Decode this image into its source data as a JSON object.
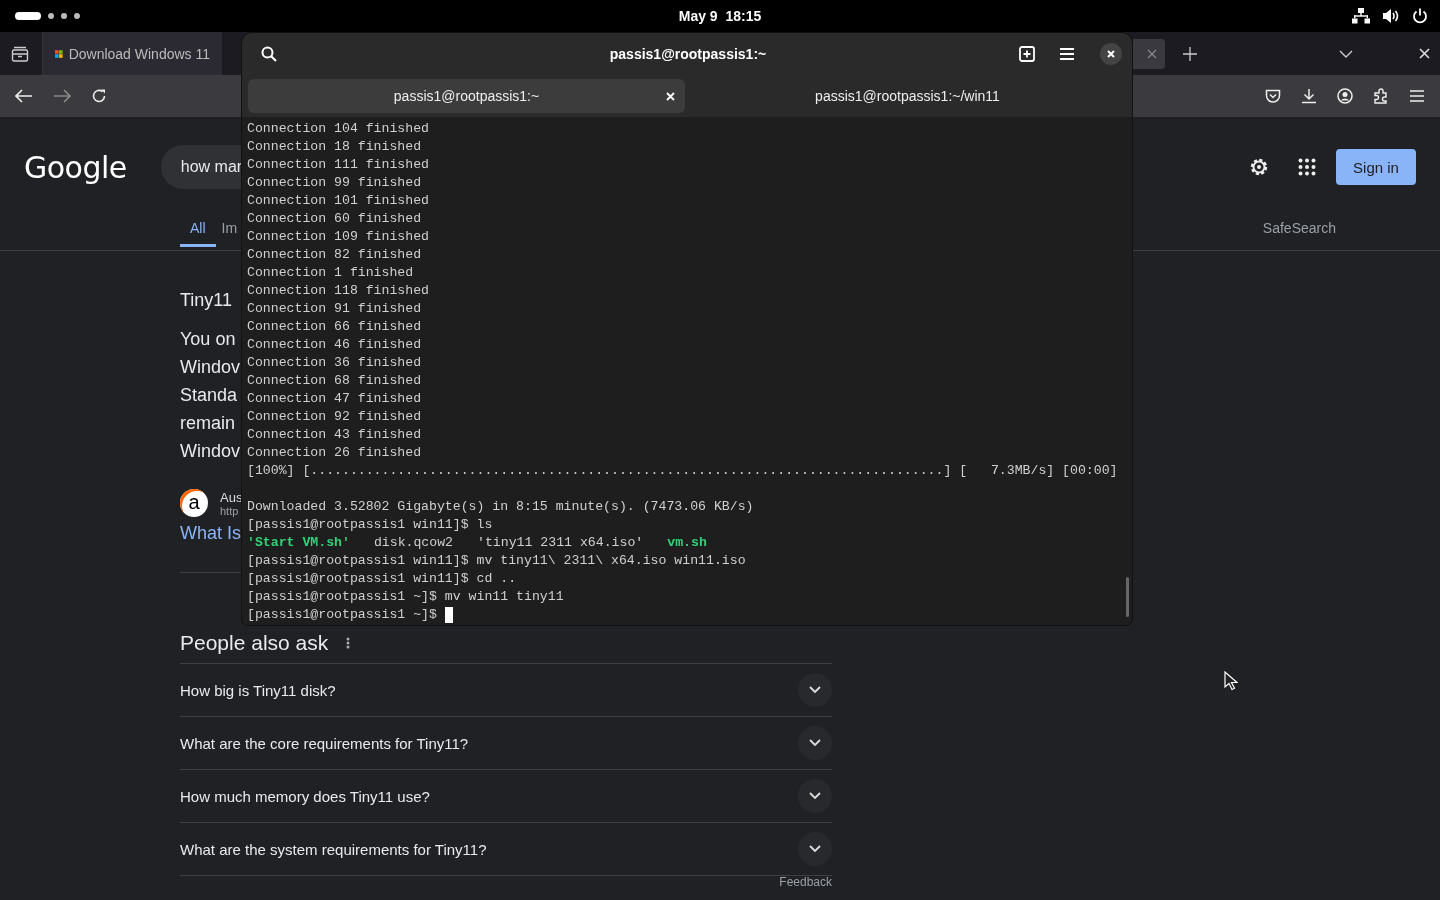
{
  "top_bar": {
    "clock": "May 9  18:15"
  },
  "browser": {
    "tabs": [
      {
        "title": "Download Windows 11",
        "selected": true
      }
    ],
    "page": {
      "logo": "Google",
      "search_query": "how mar",
      "sign_in": "Sign in",
      "search_tabs": [
        {
          "label": "All",
          "selected": true
        },
        {
          "label": "Im",
          "selected": false
        }
      ],
      "safesearch": "SafeSearch",
      "result_title": "Tiny11",
      "snippet_lines": [
        "You on",
        "Windov",
        "Standa",
        "remain",
        "Windov"
      ],
      "source": {
        "icon_letter": "a",
        "name": "Aus",
        "url": "http"
      },
      "link": "What Is",
      "people_also_ask": {
        "title": "People also ask",
        "questions": [
          {
            "text": "How big is Tiny11 disk?",
            "expanded": false
          },
          {
            "text": "What are the core requirements for Tiny11?",
            "expanded": false
          },
          {
            "text": "How much memory does Tiny11 use?",
            "expanded": false
          },
          {
            "text": "What are the system requirements for Tiny11?",
            "expanded": false
          }
        ],
        "feedback": "Feedback"
      }
    }
  },
  "terminal": {
    "title": "passis1@rootpassis1:~",
    "tabs": [
      {
        "label": "passis1@rootpassis1:~",
        "selected": true
      },
      {
        "label": "passis1@rootpassis1:~/win11",
        "selected": false
      }
    ],
    "lines": [
      {
        "kind": "text",
        "text": "Connection 104 finished"
      },
      {
        "kind": "text",
        "text": "Connection 18 finished"
      },
      {
        "kind": "text",
        "text": "Connection 111 finished"
      },
      {
        "kind": "text",
        "text": "Connection 99 finished"
      },
      {
        "kind": "text",
        "text": "Connection 101 finished"
      },
      {
        "kind": "text",
        "text": "Connection 60 finished"
      },
      {
        "kind": "text",
        "text": "Connection 109 finished"
      },
      {
        "kind": "text",
        "text": "Connection 82 finished"
      },
      {
        "kind": "text",
        "text": "Connection 1 finished"
      },
      {
        "kind": "text",
        "text": "Connection 118 finished"
      },
      {
        "kind": "text",
        "text": "Connection 91 finished"
      },
      {
        "kind": "text",
        "text": "Connection 66 finished"
      },
      {
        "kind": "text",
        "text": "Connection 46 finished"
      },
      {
        "kind": "text",
        "text": "Connection 36 finished"
      },
      {
        "kind": "text",
        "text": "Connection 68 finished"
      },
      {
        "kind": "text",
        "text": "Connection 47 finished"
      },
      {
        "kind": "text",
        "text": "Connection 92 finished"
      },
      {
        "kind": "text",
        "text": "Connection 43 finished"
      },
      {
        "kind": "text",
        "text": "Connection 26 finished"
      },
      {
        "kind": "text",
        "text": "[100%] [................................................................................] [   7.3MB/s] [00:00]"
      },
      {
        "kind": "blank"
      },
      {
        "kind": "text",
        "text": "Downloaded 3.52802 Gigabyte(s) in 8:15 minute(s). (7473.06 KB/s)"
      },
      {
        "kind": "text",
        "text": "[passis1@rootpassis1 win11]$ ls"
      },
      {
        "kind": "listing",
        "items": [
          {
            "text": "'Start VM.sh'",
            "color": "#33d17a"
          },
          {
            "text": "disk.qcow2",
            "color": "#d0d0d0"
          },
          {
            "text": "'tiny11 2311 x64.iso'",
            "color": "#d0d0d0"
          },
          {
            "text": "vm.sh",
            "color": "#33d17a"
          }
        ]
      },
      {
        "kind": "text",
        "text": "[passis1@rootpassis1 win11]$ mv tiny11\\ 2311\\ x64.iso win11.iso"
      },
      {
        "kind": "text",
        "text": "[passis1@rootpassis1 win11]$ cd .."
      },
      {
        "kind": "text",
        "text": "[passis1@rootpassis1 ~]$ mv win11 tiny11"
      },
      {
        "kind": "prompt",
        "text": "[passis1@rootpassis1 ~]$"
      }
    ]
  }
}
